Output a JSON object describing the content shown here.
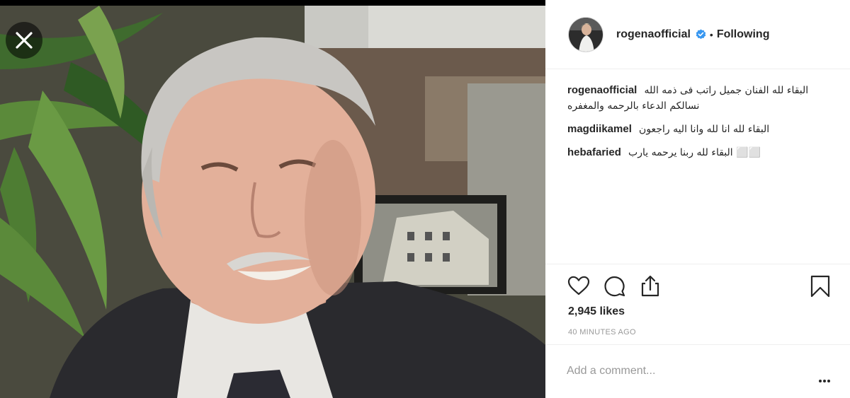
{
  "post": {
    "username": "rogenaofficial",
    "dot": "•",
    "follow_label": "Following"
  },
  "comments": [
    {
      "user": "rogenaofficial",
      "text": "البقاء لله الفنان جميل راتب فى ذمه الله نسالكم الدعاء بالرحمه والمغفره"
    },
    {
      "user": "magdiikamel",
      "text": "البقاء لله انا لله وانا اليه راجعون"
    },
    {
      "user": "hebafaried",
      "text": "البقاء لله ربنا يرحمه يارب ⬜⬜"
    }
  ],
  "stats": {
    "likes": "2,945 likes",
    "time": "40 MINUTES AGO"
  },
  "composer": {
    "placeholder": "Add a comment..."
  },
  "icons": {
    "close": "close-icon",
    "verified": "verified-badge-icon",
    "like": "heart-icon",
    "comment": "comment-bubble-icon",
    "share": "share-icon",
    "save": "bookmark-icon",
    "more": "more-options-icon"
  },
  "colors": {
    "verified": "#3897f0",
    "text": "#262626",
    "muted": "#999999",
    "border": "#efefef"
  }
}
